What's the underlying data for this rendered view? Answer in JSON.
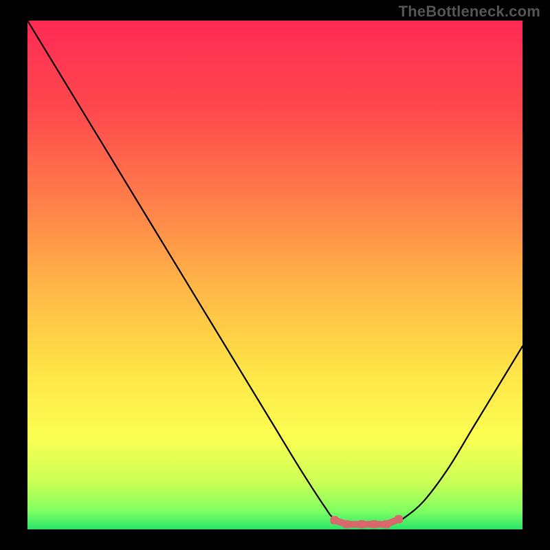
{
  "watermark": "TheBottleneck.com",
  "chart_data": {
    "type": "line",
    "title": "",
    "xlabel": "",
    "ylabel": "",
    "x": [
      0.0,
      0.05,
      0.1,
      0.15,
      0.2,
      0.25,
      0.3,
      0.35,
      0.4,
      0.45,
      0.5,
      0.55,
      0.6,
      0.62,
      0.66,
      0.7,
      0.74,
      0.76,
      0.8,
      0.85,
      0.9,
      0.95,
      1.0
    ],
    "values": [
      1.0,
      0.92,
      0.84,
      0.76,
      0.68,
      0.6,
      0.52,
      0.44,
      0.36,
      0.28,
      0.2,
      0.12,
      0.045,
      0.022,
      0.012,
      0.01,
      0.012,
      0.022,
      0.055,
      0.12,
      0.2,
      0.28,
      0.36
    ],
    "xlim": [
      0,
      1
    ],
    "ylim": [
      0,
      1
    ],
    "markers": {
      "x": [
        0.62,
        0.645,
        0.675,
        0.7,
        0.725,
        0.75
      ],
      "y": [
        0.018,
        0.01,
        0.01,
        0.01,
        0.01,
        0.02
      ],
      "color": "#d9686c"
    },
    "gradient_stops": [
      {
        "offset": 0.0,
        "color": "#ff2a55"
      },
      {
        "offset": 0.18,
        "color": "#ff4a4d"
      },
      {
        "offset": 0.36,
        "color": "#ff804a"
      },
      {
        "offset": 0.52,
        "color": "#ffb547"
      },
      {
        "offset": 0.68,
        "color": "#ffe246"
      },
      {
        "offset": 0.82,
        "color": "#fbff52"
      },
      {
        "offset": 0.91,
        "color": "#c9ff56"
      },
      {
        "offset": 0.965,
        "color": "#7dff62"
      },
      {
        "offset": 1.0,
        "color": "#27e46a"
      }
    ],
    "curve_color": "#000000",
    "curve_width": 2.2
  }
}
